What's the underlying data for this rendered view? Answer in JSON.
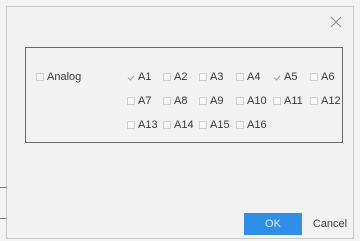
{
  "dialog": {
    "close_icon": "close-icon",
    "analog": {
      "label": "Analog",
      "checked": false
    },
    "channels": [
      {
        "label": "A1",
        "checked": true
      },
      {
        "label": "A2",
        "checked": false
      },
      {
        "label": "A3",
        "checked": false
      },
      {
        "label": "A4",
        "checked": false
      },
      {
        "label": "A5",
        "checked": true
      },
      {
        "label": "A6",
        "checked": false
      },
      {
        "label": "A7",
        "checked": false
      },
      {
        "label": "A8",
        "checked": false
      },
      {
        "label": "A9",
        "checked": false
      },
      {
        "label": "A10",
        "checked": false
      },
      {
        "label": "A11",
        "checked": false
      },
      {
        "label": "A12",
        "checked": false
      },
      {
        "label": "A13",
        "checked": false
      },
      {
        "label": "A14",
        "checked": false
      },
      {
        "label": "A15",
        "checked": false
      },
      {
        "label": "A16",
        "checked": false
      }
    ],
    "ok_label": "OK",
    "cancel_label": "Cancel"
  },
  "colors": {
    "primary_button": "#2f8ee6",
    "panel_border": "#6a6a6a"
  }
}
